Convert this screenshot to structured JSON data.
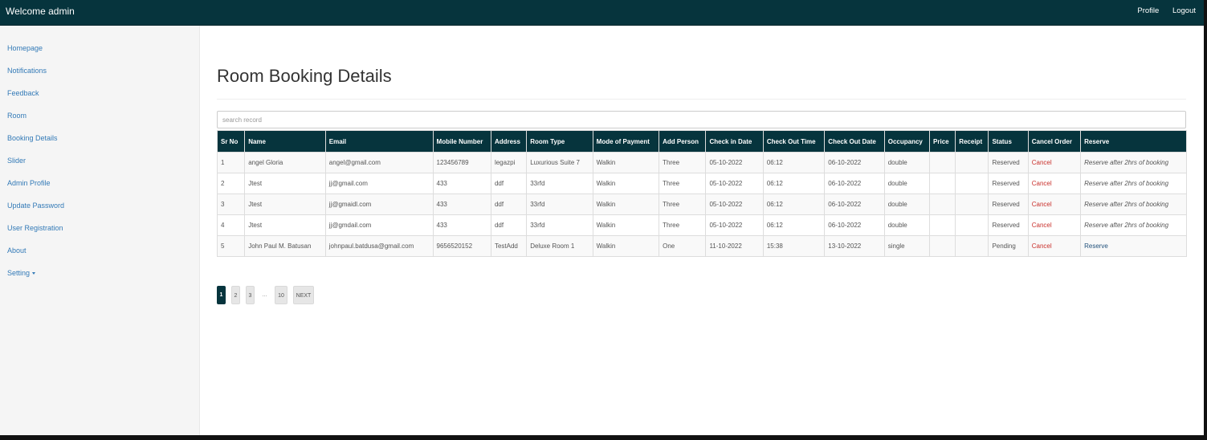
{
  "header": {
    "brand": "Welcome admin",
    "profile_label": "Profile",
    "logout_label": "Logout"
  },
  "sidebar": {
    "items": [
      {
        "label": "Homepage",
        "name": "sidebar-item-homepage"
      },
      {
        "label": "Notifications",
        "name": "sidebar-item-notifications"
      },
      {
        "label": "Feedback",
        "name": "sidebar-item-feedback"
      },
      {
        "label": "Room",
        "name": "sidebar-item-room"
      },
      {
        "label": "Booking Details",
        "name": "sidebar-item-booking-details"
      },
      {
        "label": "Slider",
        "name": "sidebar-item-slider"
      },
      {
        "label": "Admin Profile",
        "name": "sidebar-item-admin-profile"
      },
      {
        "label": "Update Password",
        "name": "sidebar-item-update-password"
      },
      {
        "label": "User Registration",
        "name": "sidebar-item-user-registration"
      },
      {
        "label": "About",
        "name": "sidebar-item-about"
      },
      {
        "label": "Setting",
        "name": "sidebar-item-setting",
        "dropdown": true
      }
    ]
  },
  "main": {
    "title": "Room Booking Details",
    "search_placeholder": "search record"
  },
  "table": {
    "columns": [
      "Sr No",
      "Name",
      "Email",
      "Mobile Number",
      "Address",
      "Room Type",
      "Mode of Payment",
      "Add Person",
      "Check in Date",
      "Check Out Time",
      "Check Out Date",
      "Occupancy",
      "Price",
      "Receipt",
      "Status",
      "Cancel Order",
      "Reserve"
    ],
    "rows": [
      {
        "sr_no": "1",
        "name": "angel Gloria",
        "email": "angel@gmail.com",
        "mobile": "123456789",
        "address": "legazpi",
        "room_type": "Luxurious Suite 7",
        "payment": "Walkin",
        "add_person": "Three",
        "check_in_date": "05-10-2022",
        "check_out_time": "06:12",
        "check_out_date": "06-10-2022",
        "occupancy": "double",
        "price": "",
        "receipt": "",
        "status": "Reserved",
        "cancel": "Cancel",
        "reserve": "Reserve after 2hrs of booking",
        "reserve_is_link": false
      },
      {
        "sr_no": "2",
        "name": "Jtest",
        "email": "jj@gmail.com",
        "mobile": "433",
        "address": "ddf",
        "room_type": "33rfd",
        "payment": "Walkin",
        "add_person": "Three",
        "check_in_date": "05-10-2022",
        "check_out_time": "06:12",
        "check_out_date": "06-10-2022",
        "occupancy": "double",
        "price": "",
        "receipt": "",
        "status": "Reserved",
        "cancel": "Cancel",
        "reserve": "Reserve after 2hrs of booking",
        "reserve_is_link": false
      },
      {
        "sr_no": "3",
        "name": "Jtest",
        "email": "jj@gmaidl.com",
        "mobile": "433",
        "address": "ddf",
        "room_type": "33rfd",
        "payment": "Walkin",
        "add_person": "Three",
        "check_in_date": "05-10-2022",
        "check_out_time": "06:12",
        "check_out_date": "06-10-2022",
        "occupancy": "double",
        "price": "",
        "receipt": "",
        "status": "Reserved",
        "cancel": "Cancel",
        "reserve": "Reserve after 2hrs of booking",
        "reserve_is_link": false
      },
      {
        "sr_no": "4",
        "name": "Jtest",
        "email": "jj@gmdail.com",
        "mobile": "433",
        "address": "ddf",
        "room_type": "33rfd",
        "payment": "Walkin",
        "add_person": "Three",
        "check_in_date": "05-10-2022",
        "check_out_time": "06:12",
        "check_out_date": "06-10-2022",
        "occupancy": "double",
        "price": "",
        "receipt": "",
        "status": "Reserved",
        "cancel": "Cancel",
        "reserve": "Reserve after 2hrs of booking",
        "reserve_is_link": false
      },
      {
        "sr_no": "5",
        "name": "John Paul M. Batusan",
        "email": "johnpaul.batdusa@gmail.com",
        "mobile": "9656520152",
        "address": "TestAdd",
        "room_type": "Deluxe Room 1",
        "payment": "Walkin",
        "add_person": "One",
        "check_in_date": "11-10-2022",
        "check_out_time": "15:38",
        "check_out_date": "13-10-2022",
        "occupancy": "single",
        "price": "",
        "receipt": "",
        "status": "Pending",
        "cancel": "Cancel",
        "reserve": "Reserve",
        "reserve_is_link": true
      }
    ]
  },
  "pagination": {
    "pages": [
      "1",
      "2",
      "3",
      "...",
      "10",
      "NEXT"
    ],
    "active": "1"
  },
  "colors": {
    "header_bg": "#06343d",
    "link": "#337ab7",
    "cancel": "#c9302c"
  }
}
